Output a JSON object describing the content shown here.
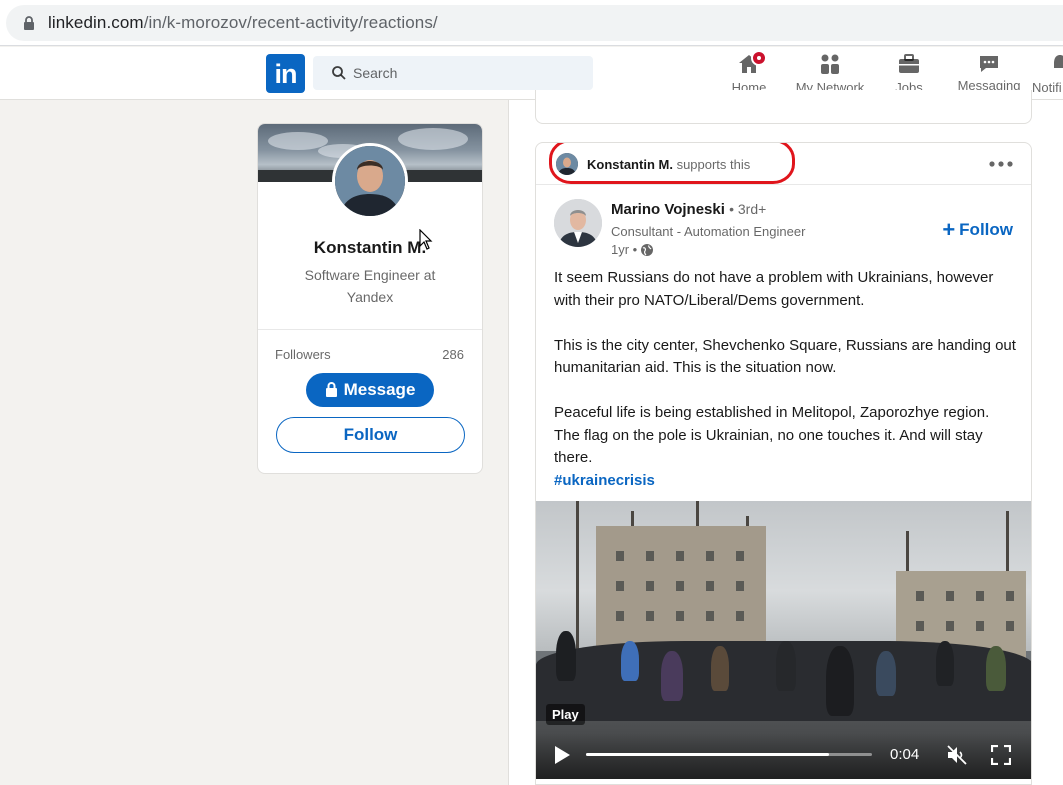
{
  "browser": {
    "url_host": "linkedin.com",
    "url_path": "/in/k-morozov/recent-activity/reactions/",
    "lock_icon": "lock-icon"
  },
  "navbar": {
    "logo": "in",
    "search_placeholder": "Search",
    "items": [
      {
        "label": "Home",
        "icon": "home-icon",
        "has_badge": true
      },
      {
        "label": "My Network",
        "icon": "network-icon"
      },
      {
        "label": "Jobs",
        "icon": "briefcase-icon"
      },
      {
        "label": "Messaging",
        "icon": "chat-icon"
      },
      {
        "label": "Notifi",
        "icon": "bell-icon"
      }
    ]
  },
  "profile": {
    "name": "Konstantin M.",
    "headline": "Software Engineer at Yandex",
    "followers_label": "Followers",
    "followers_count": "286",
    "message_label": "Message",
    "follow_label": "Follow"
  },
  "post": {
    "reaction": {
      "actor": "Konstantin M.",
      "action": "supports this"
    },
    "author": {
      "name": "Marino Vojneski",
      "degree": "• 3rd+",
      "headline": "Consultant - Automation Engineer",
      "time": "1yr •"
    },
    "follow_label": "Follow",
    "body": [
      "It seem Russians do not have a problem with Ukrainians, however with their pro NATO/Liberal/Dems government.",
      "This is the city center, Shevchenko Square, Russians are handing out humanitarian aid. This is the situation now.",
      "Peaceful life is being established in Melitopol, Zaporozhye region. The flag on the pole is Ukrainian, no one touches it. And will stay there."
    ],
    "hashtag": "#ukrainecrisis",
    "video": {
      "play_label": "Play",
      "time": "0:04",
      "progress": 0.85
    }
  },
  "colors": {
    "brand": "#0a66c2",
    "highlight": "#e0151c",
    "badge": "#cb112d"
  }
}
